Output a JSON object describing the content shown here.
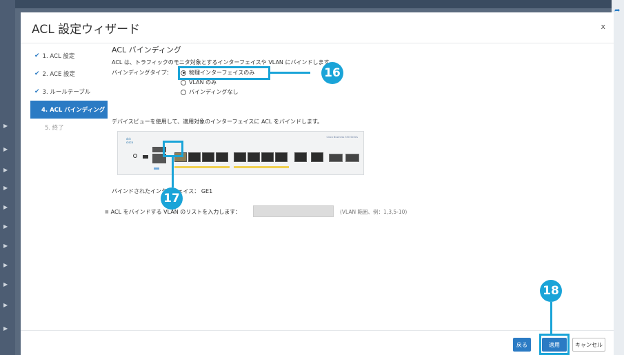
{
  "dialog": {
    "title": "ACL 設定ウィザード",
    "close_label": "x"
  },
  "nav": {
    "items": [
      {
        "label": "1. ACL 設定",
        "state": "done"
      },
      {
        "label": "2. ACE 設定",
        "state": "done"
      },
      {
        "label": "3. ルールテーブル",
        "state": "done"
      },
      {
        "label": "4. ACL バインディング",
        "state": "active"
      },
      {
        "label": "5. 終了",
        "state": "pending"
      }
    ],
    "check_glyph": "✔"
  },
  "main": {
    "section_title": "ACL バインディング",
    "description": "ACL は、トラフィックのモニタ対象とするインターフェイスや VLAN にバインドします。",
    "binding_type_label": "バインディングタイプ：",
    "binding_options": [
      {
        "label": "物理インターフェイスのみ",
        "selected": true
      },
      {
        "label": "VLAN のみ",
        "selected": false
      },
      {
        "label": "バインディングなし",
        "selected": false
      }
    ],
    "device_view_note": "デバイスビューを使用して、適用対象のインターフェイスに ACL をバインドします。",
    "device": {
      "logo": "cisco",
      "model": "Cisco Business 350 Series",
      "selected_port": "GE1"
    },
    "bound_label": "バインドされたインターフェイス：",
    "bound_value": "GE1",
    "vlan_prompt": "ACL をバインドする VLAN のリストを入力します：",
    "vlan_value": "",
    "vlan_hint": "(VLAN 範囲、例：1,3,5-10)"
  },
  "footer": {
    "back_label": "戻る",
    "apply_label": "適用",
    "cancel_label": "キャンセル"
  },
  "callouts": {
    "c16": "16",
    "c17": "17",
    "c18": "18",
    "color": "#1aa4d8"
  }
}
